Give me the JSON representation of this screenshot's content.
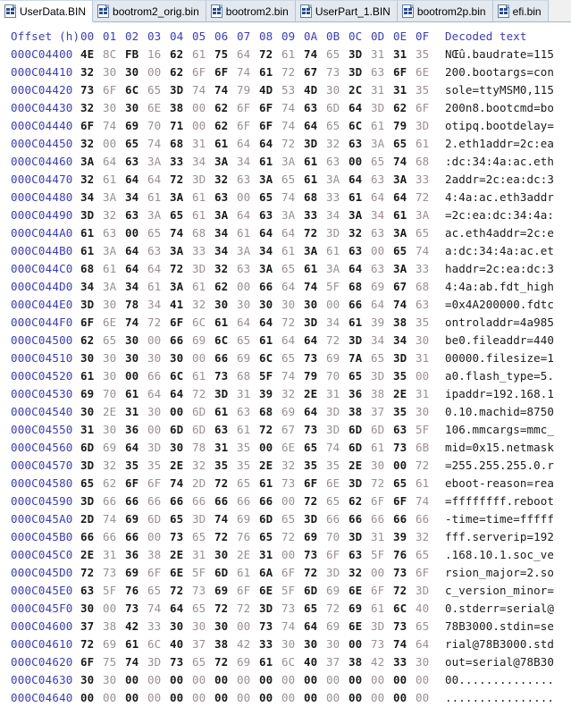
{
  "tabs": [
    {
      "label": "UserData.BIN",
      "icon": "hex-file-icon",
      "active": true
    },
    {
      "label": "bootrom2_orig.bin",
      "icon": "hex-file-icon",
      "active": false
    },
    {
      "label": "bootrom2.bin",
      "icon": "hex-file-icon",
      "active": false
    },
    {
      "label": "UserPart_1.BIN",
      "icon": "hex-file-icon",
      "active": false
    },
    {
      "label": "bootrom2p.bin",
      "icon": "hex-file-icon",
      "active": false
    },
    {
      "label": "efi.bin",
      "icon": "hex-file-icon",
      "active": false
    }
  ],
  "header": {
    "offset_label": "Offset (h)",
    "columns": [
      "00",
      "01",
      "02",
      "03",
      "04",
      "05",
      "06",
      "07",
      "08",
      "09",
      "0A",
      "0B",
      "0C",
      "0D",
      "0E",
      "0F"
    ],
    "decoded_label": "Decoded text"
  },
  "colors": {
    "offset": "#3b3bbf",
    "byte_even": "#1a1a1a",
    "byte_odd": "#9a8f8f",
    "ascii": "#1a1a1a",
    "tab_active_bg": "#ffffff",
    "tab_inactive_bg": "#e4e9ef"
  },
  "rows": [
    {
      "offset": "000C04400",
      "bytes": [
        "4E",
        "8C",
        "FB",
        "16",
        "62",
        "61",
        "75",
        "64",
        "72",
        "61",
        "74",
        "65",
        "3D",
        "31",
        "31",
        "35"
      ],
      "ascii": "NŒû.baudrate=115"
    },
    {
      "offset": "000C04410",
      "bytes": [
        "32",
        "30",
        "30",
        "00",
        "62",
        "6F",
        "6F",
        "74",
        "61",
        "72",
        "67",
        "73",
        "3D",
        "63",
        "6F",
        "6E"
      ],
      "ascii": "200.bootargs=con"
    },
    {
      "offset": "000C04420",
      "bytes": [
        "73",
        "6F",
        "6C",
        "65",
        "3D",
        "74",
        "74",
        "79",
        "4D",
        "53",
        "4D",
        "30",
        "2C",
        "31",
        "31",
        "35"
      ],
      "ascii": "sole=ttyMSM0,115"
    },
    {
      "offset": "000C04430",
      "bytes": [
        "32",
        "30",
        "30",
        "6E",
        "38",
        "00",
        "62",
        "6F",
        "6F",
        "74",
        "63",
        "6D",
        "64",
        "3D",
        "62",
        "6F"
      ],
      "ascii": "200n8.bootcmd=bo"
    },
    {
      "offset": "000C04440",
      "bytes": [
        "6F",
        "74",
        "69",
        "70",
        "71",
        "00",
        "62",
        "6F",
        "6F",
        "74",
        "64",
        "65",
        "6C",
        "61",
        "79",
        "3D"
      ],
      "ascii": "otipq.bootdelay="
    },
    {
      "offset": "000C04450",
      "bytes": [
        "32",
        "00",
        "65",
        "74",
        "68",
        "31",
        "61",
        "64",
        "64",
        "72",
        "3D",
        "32",
        "63",
        "3A",
        "65",
        "61"
      ],
      "ascii": "2.eth1addr=2c:ea"
    },
    {
      "offset": "000C04460",
      "bytes": [
        "3A",
        "64",
        "63",
        "3A",
        "33",
        "34",
        "3A",
        "34",
        "61",
        "3A",
        "61",
        "63",
        "00",
        "65",
        "74",
        "68"
      ],
      "ascii": ":dc:34:4a:ac.eth"
    },
    {
      "offset": "000C04470",
      "bytes": [
        "32",
        "61",
        "64",
        "64",
        "72",
        "3D",
        "32",
        "63",
        "3A",
        "65",
        "61",
        "3A",
        "64",
        "63",
        "3A",
        "33"
      ],
      "ascii": "2addr=2c:ea:dc:3"
    },
    {
      "offset": "000C04480",
      "bytes": [
        "34",
        "3A",
        "34",
        "61",
        "3A",
        "61",
        "63",
        "00",
        "65",
        "74",
        "68",
        "33",
        "61",
        "64",
        "64",
        "72"
      ],
      "ascii": "4:4a:ac.eth3addr"
    },
    {
      "offset": "000C04490",
      "bytes": [
        "3D",
        "32",
        "63",
        "3A",
        "65",
        "61",
        "3A",
        "64",
        "63",
        "3A",
        "33",
        "34",
        "3A",
        "34",
        "61",
        "3A"
      ],
      "ascii": "=2c:ea:dc:34:4a:"
    },
    {
      "offset": "000C044A0",
      "bytes": [
        "61",
        "63",
        "00",
        "65",
        "74",
        "68",
        "34",
        "61",
        "64",
        "64",
        "72",
        "3D",
        "32",
        "63",
        "3A",
        "65"
      ],
      "ascii": "ac.eth4addr=2c:e"
    },
    {
      "offset": "000C044B0",
      "bytes": [
        "61",
        "3A",
        "64",
        "63",
        "3A",
        "33",
        "34",
        "3A",
        "34",
        "61",
        "3A",
        "61",
        "63",
        "00",
        "65",
        "74"
      ],
      "ascii": "a:dc:34:4a:ac.et"
    },
    {
      "offset": "000C044C0",
      "bytes": [
        "68",
        "61",
        "64",
        "64",
        "72",
        "3D",
        "32",
        "63",
        "3A",
        "65",
        "61",
        "3A",
        "64",
        "63",
        "3A",
        "33"
      ],
      "ascii": "haddr=2c:ea:dc:3"
    },
    {
      "offset": "000C044D0",
      "bytes": [
        "34",
        "3A",
        "34",
        "61",
        "3A",
        "61",
        "62",
        "00",
        "66",
        "64",
        "74",
        "5F",
        "68",
        "69",
        "67",
        "68"
      ],
      "ascii": "4:4a:ab.fdt_high"
    },
    {
      "offset": "000C044E0",
      "bytes": [
        "3D",
        "30",
        "78",
        "34",
        "41",
        "32",
        "30",
        "30",
        "30",
        "30",
        "30",
        "00",
        "66",
        "64",
        "74",
        "63"
      ],
      "ascii": "=0x4A200000.fdtc"
    },
    {
      "offset": "000C044F0",
      "bytes": [
        "6F",
        "6E",
        "74",
        "72",
        "6F",
        "6C",
        "61",
        "64",
        "64",
        "72",
        "3D",
        "34",
        "61",
        "39",
        "38",
        "35"
      ],
      "ascii": "ontroladdr=4a985"
    },
    {
      "offset": "000C04500",
      "bytes": [
        "62",
        "65",
        "30",
        "00",
        "66",
        "69",
        "6C",
        "65",
        "61",
        "64",
        "64",
        "72",
        "3D",
        "34",
        "34",
        "30"
      ],
      "ascii": "be0.fileaddr=440"
    },
    {
      "offset": "000C04510",
      "bytes": [
        "30",
        "30",
        "30",
        "30",
        "30",
        "00",
        "66",
        "69",
        "6C",
        "65",
        "73",
        "69",
        "7A",
        "65",
        "3D",
        "31"
      ],
      "ascii": "00000.filesize=1"
    },
    {
      "offset": "000C04520",
      "bytes": [
        "61",
        "30",
        "00",
        "66",
        "6C",
        "61",
        "73",
        "68",
        "5F",
        "74",
        "79",
        "70",
        "65",
        "3D",
        "35",
        "00"
      ],
      "ascii": "a0.flash_type=5."
    },
    {
      "offset": "000C04530",
      "bytes": [
        "69",
        "70",
        "61",
        "64",
        "64",
        "72",
        "3D",
        "31",
        "39",
        "32",
        "2E",
        "31",
        "36",
        "38",
        "2E",
        "31"
      ],
      "ascii": "ipaddr=192.168.1"
    },
    {
      "offset": "000C04540",
      "bytes": [
        "30",
        "2E",
        "31",
        "30",
        "00",
        "6D",
        "61",
        "63",
        "68",
        "69",
        "64",
        "3D",
        "38",
        "37",
        "35",
        "30"
      ],
      "ascii": "0.10.machid=8750"
    },
    {
      "offset": "000C04550",
      "bytes": [
        "31",
        "30",
        "36",
        "00",
        "6D",
        "6D",
        "63",
        "61",
        "72",
        "67",
        "73",
        "3D",
        "6D",
        "6D",
        "63",
        "5F"
      ],
      "ascii": "106.mmcargs=mmc_"
    },
    {
      "offset": "000C04560",
      "bytes": [
        "6D",
        "69",
        "64",
        "3D",
        "30",
        "78",
        "31",
        "35",
        "00",
        "6E",
        "65",
        "74",
        "6D",
        "61",
        "73",
        "6B"
      ],
      "ascii": "mid=0x15.netmask"
    },
    {
      "offset": "000C04570",
      "bytes": [
        "3D",
        "32",
        "35",
        "35",
        "2E",
        "32",
        "35",
        "35",
        "2E",
        "32",
        "35",
        "35",
        "2E",
        "30",
        "00",
        "72"
      ],
      "ascii": "=255.255.255.0.r"
    },
    {
      "offset": "000C04580",
      "bytes": [
        "65",
        "62",
        "6F",
        "6F",
        "74",
        "2D",
        "72",
        "65",
        "61",
        "73",
        "6F",
        "6E",
        "3D",
        "72",
        "65",
        "61"
      ],
      "ascii": "eboot-reason=rea"
    },
    {
      "offset": "000C04590",
      "bytes": [
        "3D",
        "66",
        "66",
        "66",
        "66",
        "66",
        "66",
        "66",
        "66",
        "00",
        "72",
        "65",
        "62",
        "6F",
        "6F",
        "74"
      ],
      "ascii": "=ffffffff.reboot"
    },
    {
      "offset": "000C045A0",
      "bytes": [
        "2D",
        "74",
        "69",
        "6D",
        "65",
        "3D",
        "74",
        "69",
        "6D",
        "65",
        "3D",
        "66",
        "66",
        "66",
        "66",
        "66"
      ],
      "ascii": "-time=time=fffff"
    },
    {
      "offset": "000C045B0",
      "bytes": [
        "66",
        "66",
        "66",
        "00",
        "73",
        "65",
        "72",
        "76",
        "65",
        "72",
        "69",
        "70",
        "3D",
        "31",
        "39",
        "32"
      ],
      "ascii": "fff.serverip=192"
    },
    {
      "offset": "000C045C0",
      "bytes": [
        "2E",
        "31",
        "36",
        "38",
        "2E",
        "31",
        "30",
        "2E",
        "31",
        "00",
        "73",
        "6F",
        "63",
        "5F",
        "76",
        "65"
      ],
      "ascii": ".168.10.1.soc_ve"
    },
    {
      "offset": "000C045D0",
      "bytes": [
        "72",
        "73",
        "69",
        "6F",
        "6E",
        "5F",
        "6D",
        "61",
        "6A",
        "6F",
        "72",
        "3D",
        "32",
        "00",
        "73",
        "6F"
      ],
      "ascii": "rsion_major=2.so"
    },
    {
      "offset": "000C045E0",
      "bytes": [
        "63",
        "5F",
        "76",
        "65",
        "72",
        "73",
        "69",
        "6F",
        "6E",
        "5F",
        "6D",
        "69",
        "6E",
        "6F",
        "72",
        "3D"
      ],
      "ascii": "c_version_minor="
    },
    {
      "offset": "000C045F0",
      "bytes": [
        "30",
        "00",
        "73",
        "74",
        "64",
        "65",
        "72",
        "72",
        "3D",
        "73",
        "65",
        "72",
        "69",
        "61",
        "6C",
        "40"
      ],
      "ascii": "0.stderr=serial@"
    },
    {
      "offset": "000C04600",
      "bytes": [
        "37",
        "38",
        "42",
        "33",
        "30",
        "30",
        "30",
        "00",
        "73",
        "74",
        "64",
        "69",
        "6E",
        "3D",
        "73",
        "65"
      ],
      "ascii": "78B3000.stdin=se"
    },
    {
      "offset": "000C04610",
      "bytes": [
        "72",
        "69",
        "61",
        "6C",
        "40",
        "37",
        "38",
        "42",
        "33",
        "30",
        "30",
        "30",
        "00",
        "73",
        "74",
        "64"
      ],
      "ascii": "rial@78B3000.std"
    },
    {
      "offset": "000C04620",
      "bytes": [
        "6F",
        "75",
        "74",
        "3D",
        "73",
        "65",
        "72",
        "69",
        "61",
        "6C",
        "40",
        "37",
        "38",
        "42",
        "33",
        "30"
      ],
      "ascii": "out=serial@78B30"
    },
    {
      "offset": "000C04630",
      "bytes": [
        "30",
        "30",
        "00",
        "00",
        "00",
        "00",
        "00",
        "00",
        "00",
        "00",
        "00",
        "00",
        "00",
        "00",
        "00",
        "00"
      ],
      "ascii": "00.............."
    },
    {
      "offset": "000C04640",
      "bytes": [
        "00",
        "00",
        "00",
        "00",
        "00",
        "00",
        "00",
        "00",
        "00",
        "00",
        "00",
        "00",
        "00",
        "00",
        "00",
        "00"
      ],
      "ascii": "................"
    }
  ]
}
